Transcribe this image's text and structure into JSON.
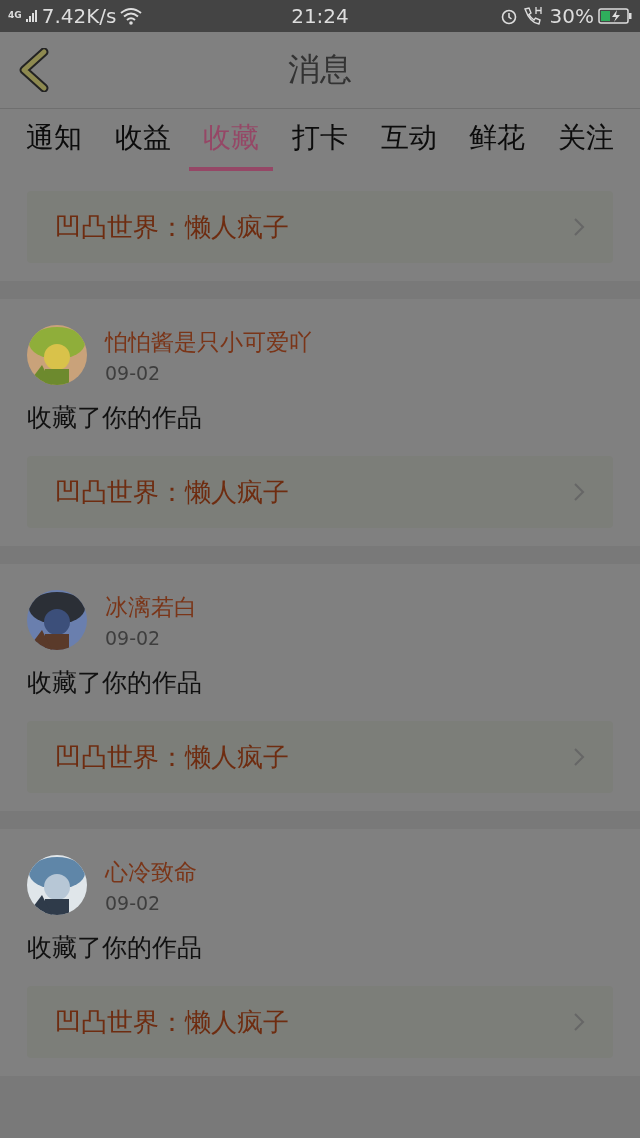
{
  "status_bar": {
    "network": "4G",
    "speed": "7.42K/s",
    "time": "21:24",
    "battery": "30%",
    "charging": true
  },
  "header": {
    "title": "消息"
  },
  "tabs": [
    {
      "label": "通知",
      "selected": false
    },
    {
      "label": "收益",
      "selected": false
    },
    {
      "label": "收藏",
      "selected": true
    },
    {
      "label": "打卡",
      "selected": false
    },
    {
      "label": "互动",
      "selected": false
    },
    {
      "label": "鲜花",
      "selected": false
    },
    {
      "label": "关注",
      "selected": false
    }
  ],
  "messages": [
    {
      "work": "凹凸世界：懒人疯子"
    },
    {
      "user": "怕怕酱是只小可爱吖",
      "date": "09-02",
      "action": "收藏了你的作品",
      "work": "凹凸世界：懒人疯子"
    },
    {
      "user": "冰漓若白",
      "date": "09-02",
      "action": "收藏了你的作品",
      "work": "凹凸世界：懒人疯子"
    },
    {
      "user": "心冷致命",
      "date": "09-02",
      "action": "收藏了你的作品",
      "work": "凹凸世界：懒人疯子"
    }
  ]
}
